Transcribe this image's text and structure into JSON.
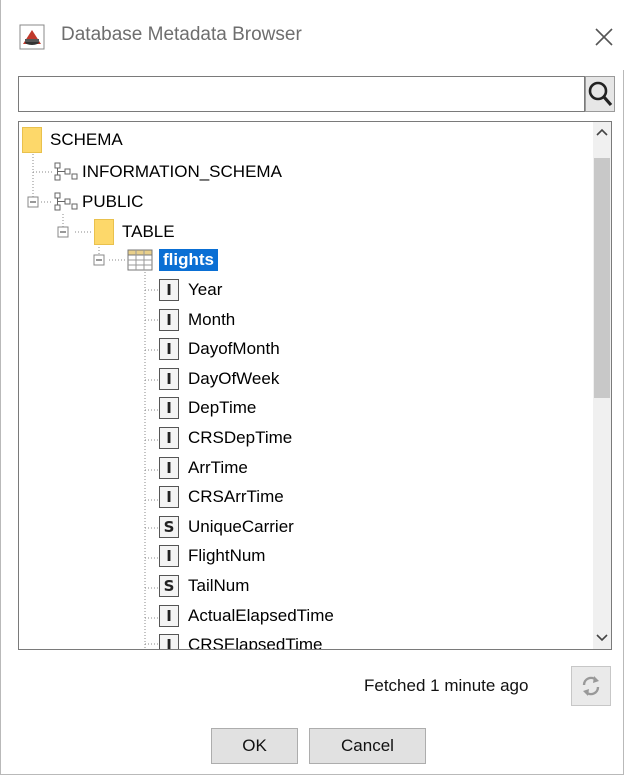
{
  "window": {
    "title": "Database Metadata Browser",
    "app_icon": "database-app-icon",
    "close_icon": "close-icon"
  },
  "search": {
    "value": "",
    "placeholder": "",
    "icon": "search-icon"
  },
  "tree": {
    "root": {
      "label": "SCHEMA",
      "icon": "folder-icon"
    },
    "schemas": [
      {
        "label": "INFORMATION_SCHEMA",
        "icon": "schema-icon",
        "expanded": false
      },
      {
        "label": "PUBLIC",
        "icon": "schema-icon",
        "expanded": true
      }
    ],
    "table_folder": {
      "label": "TABLE",
      "icon": "folder-icon",
      "expanded": true
    },
    "table": {
      "label": "flights",
      "icon": "table-icon",
      "selected": true,
      "expanded": true
    },
    "columns": [
      {
        "type": "I",
        "name": "Year"
      },
      {
        "type": "I",
        "name": "Month"
      },
      {
        "type": "I",
        "name": "DayofMonth"
      },
      {
        "type": "I",
        "name": "DayOfWeek"
      },
      {
        "type": "I",
        "name": "DepTime"
      },
      {
        "type": "I",
        "name": "CRSDepTime"
      },
      {
        "type": "I",
        "name": "ArrTime"
      },
      {
        "type": "I",
        "name": "CRSArrTime"
      },
      {
        "type": "S",
        "name": "UniqueCarrier"
      },
      {
        "type": "I",
        "name": "FlightNum"
      },
      {
        "type": "S",
        "name": "TailNum"
      },
      {
        "type": "I",
        "name": "ActualElapsedTime"
      },
      {
        "type": "I",
        "name": "CRSElapsedTime"
      }
    ]
  },
  "footer": {
    "status": "Fetched 1 minute ago",
    "refresh_icon": "refresh-icon"
  },
  "buttons": {
    "ok": "OK",
    "cancel": "Cancel"
  },
  "colors": {
    "selection": "#0a6fd4",
    "folder": "#fdd86a"
  }
}
